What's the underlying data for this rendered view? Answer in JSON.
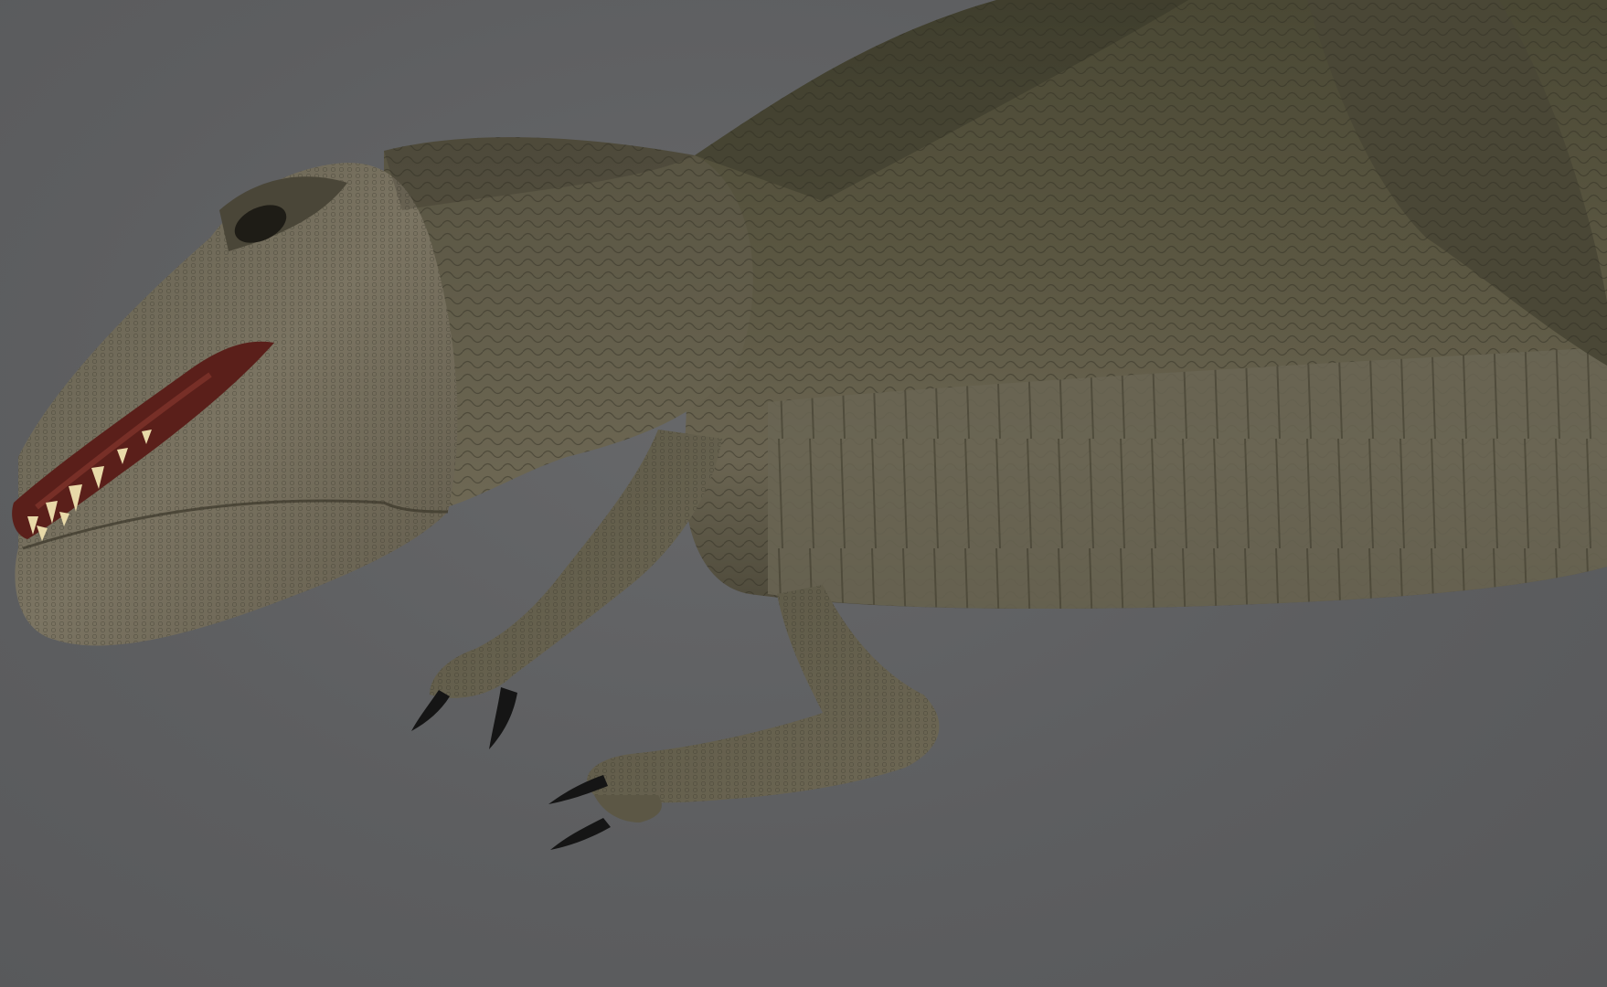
{
  "viewport": {
    "background_color": "#5d5e60"
  },
  "subject": {
    "kind": "dinosaur-3d-model",
    "colors": {
      "skin_dark": "#3f3d2e",
      "skin_mid": "#5e5a45",
      "skin_light": "#8a8270",
      "mouth": "#5a1f1a",
      "teeth": "#e8d9a8",
      "claw": "#151515"
    }
  }
}
